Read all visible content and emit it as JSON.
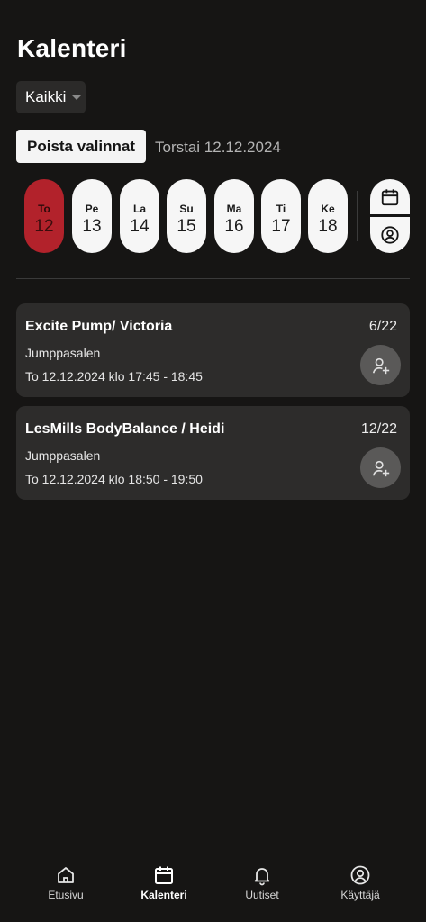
{
  "header": {
    "title": "Kalenteri"
  },
  "filter": {
    "selected": "Kaikki"
  },
  "actions": {
    "clear_label": "Poista valinnat",
    "selected_date": "Torstai 12.12.2024"
  },
  "days": [
    {
      "name": "To",
      "date": "12",
      "active": true
    },
    {
      "name": "Pe",
      "date": "13"
    },
    {
      "name": "La",
      "date": "14"
    },
    {
      "name": "Su",
      "date": "15"
    },
    {
      "name": "Ma",
      "date": "16"
    },
    {
      "name": "Ti",
      "date": "17"
    },
    {
      "name": "Ke",
      "date": "18"
    }
  ],
  "classes": [
    {
      "name": "Excite Pump/ Victoria",
      "count": "6/22",
      "location": "Jumppasalen",
      "time": "To 12.12.2024 klo 17:45 - 18:45"
    },
    {
      "name": "LesMills BodyBalance / Heidi",
      "count": "12/22",
      "location": "Jumppasalen",
      "time": "To 12.12.2024 klo 18:50 - 19:50"
    }
  ],
  "nav": [
    {
      "label": "Etusivu",
      "icon": "home-icon"
    },
    {
      "label": "Kalenteri",
      "icon": "calendar-icon",
      "active": true
    },
    {
      "label": "Uutiset",
      "icon": "bell-icon"
    },
    {
      "label": "Käyttäjä",
      "icon": "user-icon"
    }
  ],
  "colors": {
    "accent": "#b2222b",
    "background": "#161514",
    "card": "#2d2c2b"
  }
}
